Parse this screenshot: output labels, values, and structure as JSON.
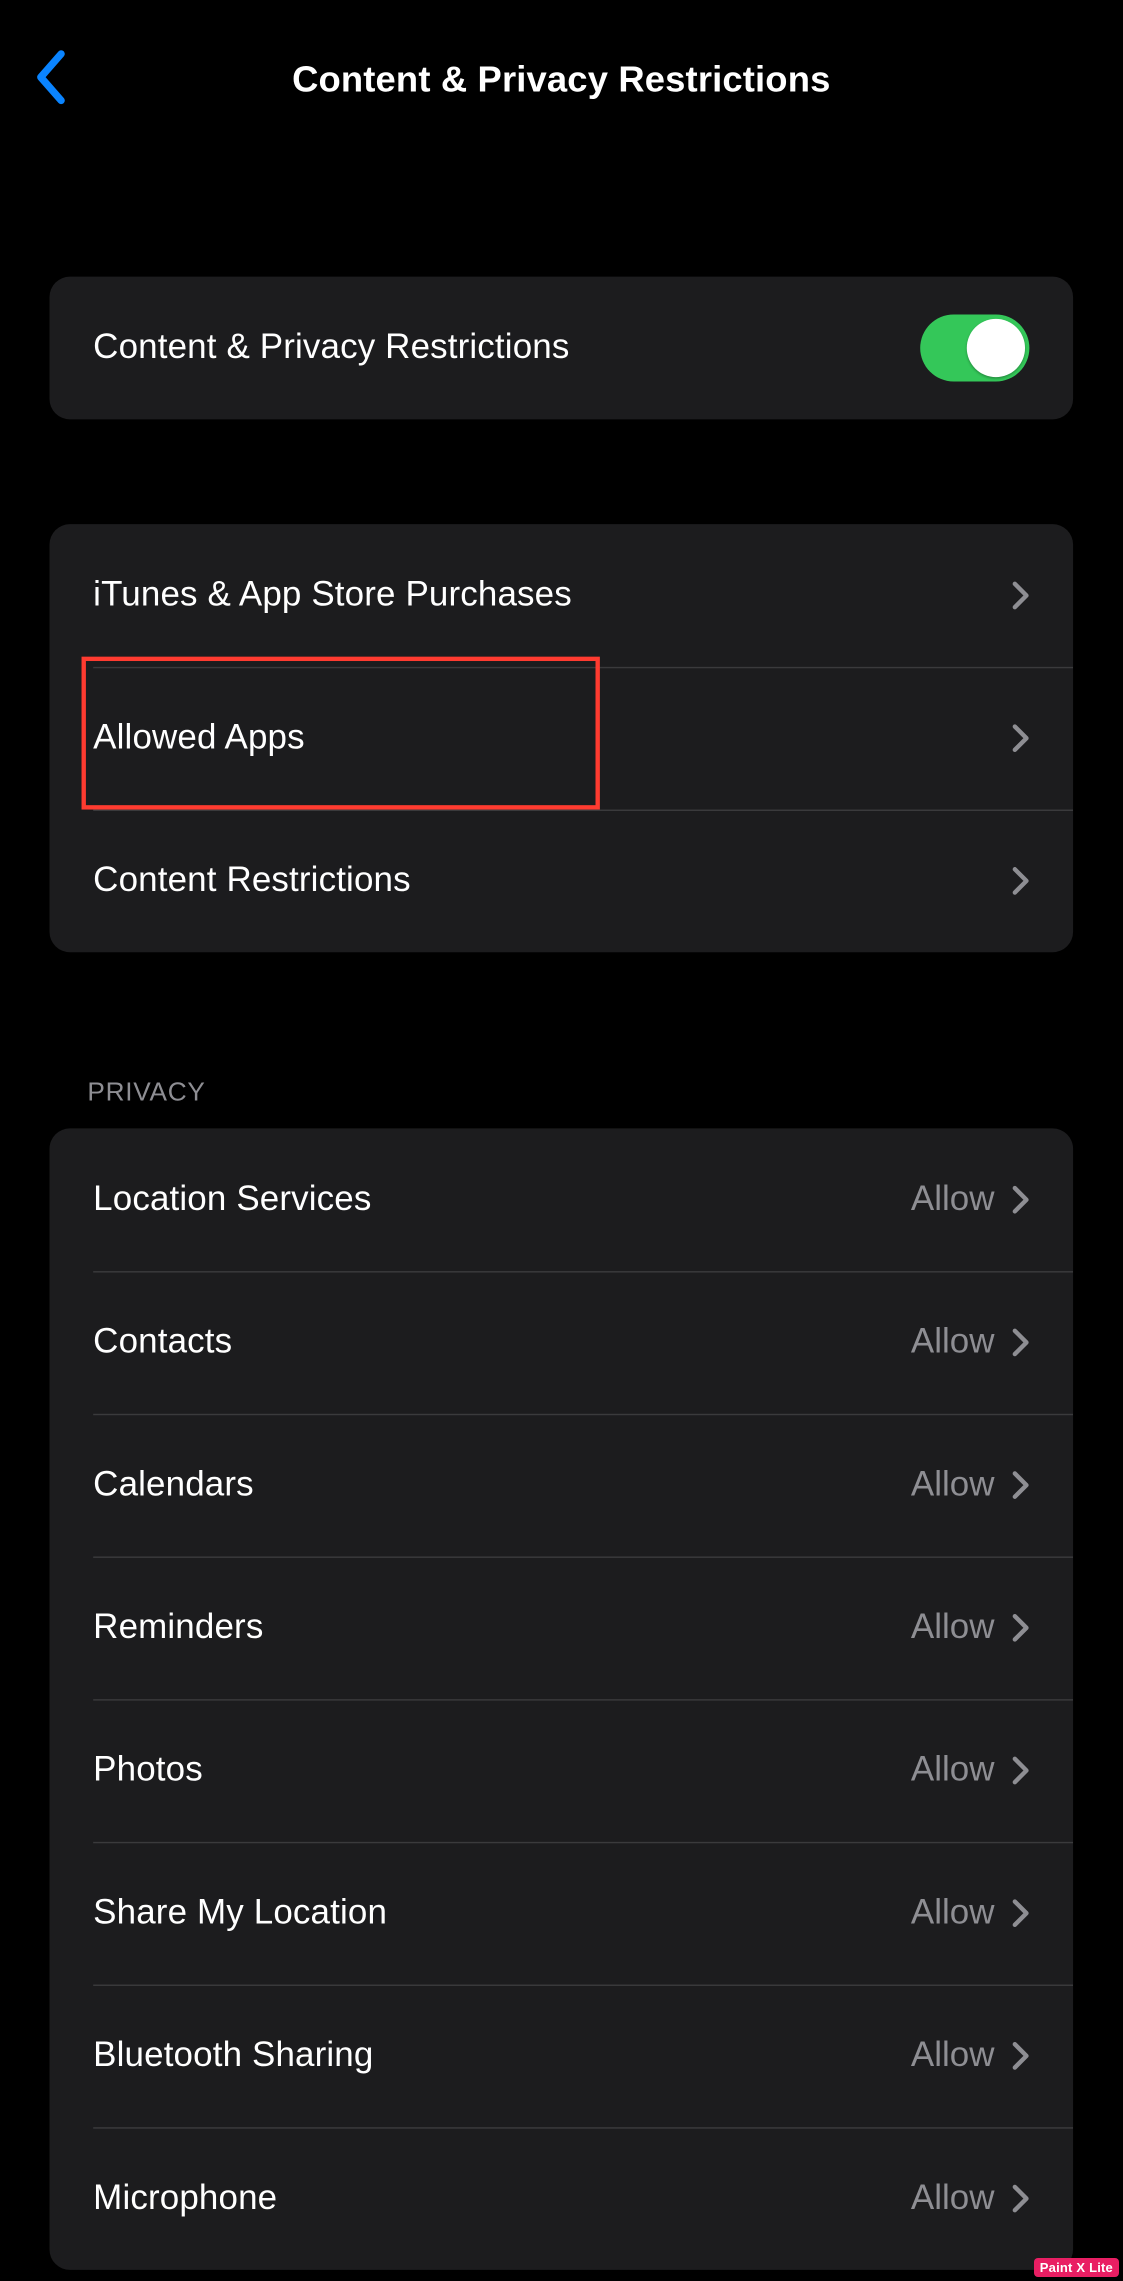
{
  "page_title": "Content & Privacy Restrictions",
  "toggle": {
    "label": "Content & Privacy Restrictions",
    "on": true
  },
  "main_rows": [
    {
      "label": "iTunes & App Store Purchases"
    },
    {
      "label": "Allowed Apps",
      "highlighted": true
    },
    {
      "label": "Content Restrictions"
    }
  ],
  "privacy_section_header": "PRIVACY",
  "privacy_rows": [
    {
      "label": "Location Services",
      "value": "Allow"
    },
    {
      "label": "Contacts",
      "value": "Allow"
    },
    {
      "label": "Calendars",
      "value": "Allow"
    },
    {
      "label": "Reminders",
      "value": "Allow"
    },
    {
      "label": "Photos",
      "value": "Allow"
    },
    {
      "label": "Share My Location",
      "value": "Allow"
    },
    {
      "label": "Bluetooth Sharing",
      "value": "Allow"
    },
    {
      "label": "Microphone",
      "value": "Allow"
    }
  ],
  "watermark": "Paint X Lite"
}
